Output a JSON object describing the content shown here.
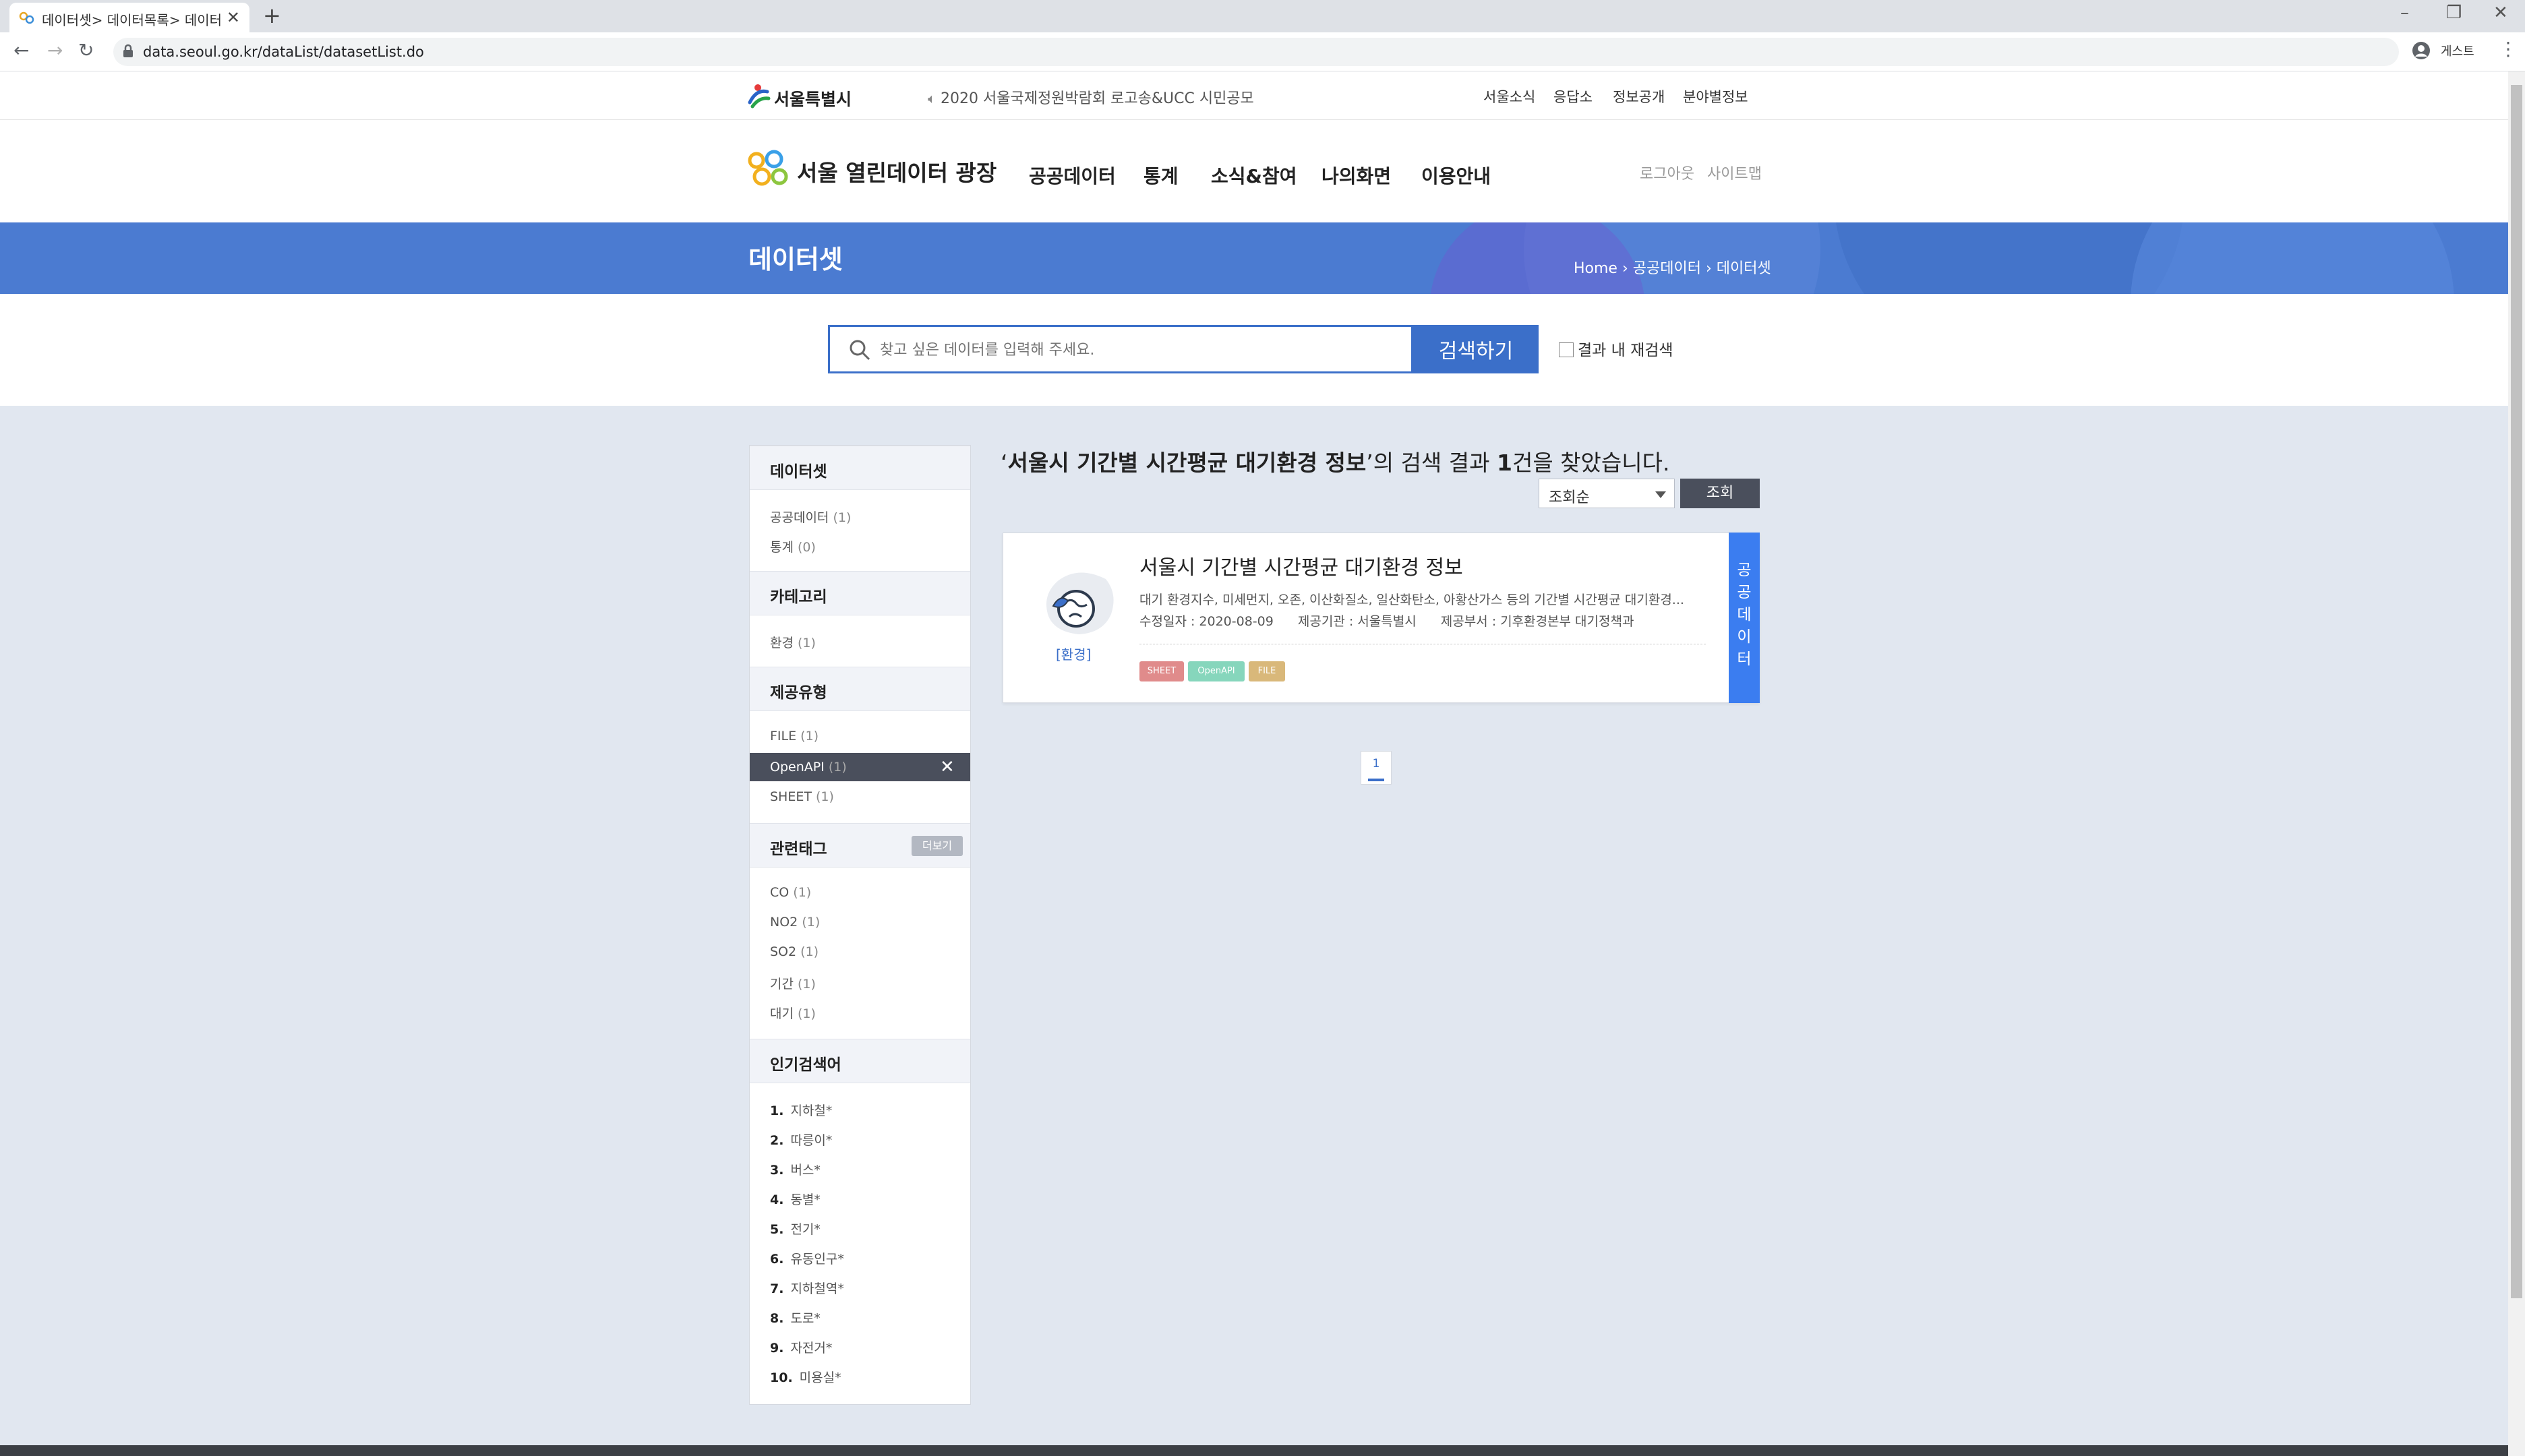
{
  "browser": {
    "tab_title": "데이터셋> 데이터목록> 데이터",
    "url": "data.seoul.go.kr/dataList/datasetList.do",
    "profile_label": "게스트"
  },
  "topbar": {
    "seoul_label": "서울특별시",
    "notice": "2020 서울국제정원박람회 로고송&UCC 시민공모",
    "links": [
      "서울소식",
      "응답소",
      "정보공개",
      "분야별정보"
    ]
  },
  "gnb": {
    "site_name": "서울 열린데이터 광장",
    "menu": [
      "공공데이터",
      "통계",
      "소식&참여",
      "나의화면",
      "이용안내"
    ],
    "logout": "로그아웃",
    "sitemap": "사이트맵"
  },
  "banner": {
    "title": "데이터셋",
    "breadcrumb": [
      "Home",
      "공공데이터",
      "데이터셋"
    ]
  },
  "search": {
    "placeholder": "찾고 싶은 데이터를 입력해 주세요.",
    "button": "검색하기",
    "research_label": "결과 내 재검색"
  },
  "sidebar": {
    "sections": [
      {
        "title": "데이터셋",
        "items": [
          {
            "label": "공공데이터",
            "count": "(1)"
          },
          {
            "label": "통계",
            "count": "(0)"
          }
        ]
      },
      {
        "title": "카테고리",
        "items": [
          {
            "label": "환경",
            "count": "(1)"
          }
        ]
      },
      {
        "title": "제공유형",
        "items": [
          {
            "label": "FILE",
            "count": "(1)"
          },
          {
            "label": "OpenAPI",
            "count": "(1)"
          },
          {
            "label": "SHEET",
            "count": "(1)"
          }
        ]
      },
      {
        "title": "관련태그",
        "more": "더보기",
        "items": [
          {
            "label": "CO",
            "count": "(1)"
          },
          {
            "label": "NO2",
            "count": "(1)"
          },
          {
            "label": "SO2",
            "count": "(1)"
          },
          {
            "label": "기간",
            "count": "(1)"
          },
          {
            "label": "대기",
            "count": "(1)"
          }
        ]
      },
      {
        "title": "인기검색어",
        "items": [
          {
            "rank": "1.",
            "label": "지하철*"
          },
          {
            "rank": "2.",
            "label": "따릉이*"
          },
          {
            "rank": "3.",
            "label": "버스*"
          },
          {
            "rank": "4.",
            "label": "동별*"
          },
          {
            "rank": "5.",
            "label": "전기*"
          },
          {
            "rank": "6.",
            "label": "유동인구*"
          },
          {
            "rank": "7.",
            "label": "지하철역*"
          },
          {
            "rank": "8.",
            "label": "도로*"
          },
          {
            "rank": "9.",
            "label": "자전거*"
          },
          {
            "rank": "10.",
            "label": "미용실*"
          }
        ]
      }
    ]
  },
  "results": {
    "query": "서울시 기간별 시간평균 대기환경 정보",
    "suffix1": "의 검색 결과 ",
    "count": "1",
    "suffix2": "건을 찾았습니다.",
    "sort_value": "조회순",
    "sort_button": "조회",
    "card": {
      "category": "[환경]",
      "title": "서울시 기간별 시간평균 대기환경 정보",
      "description": "대기 환경지수, 미세먼지, 오존, 이산화질소, 일산화탄소, 아황산가스 등의 기간별 시간평균 대기환경...",
      "modified": "수정일자 : 2020-08-09",
      "provider": "제공기관 : 서울특별시",
      "department": "제공부서 : 기후환경본부 대기정책과",
      "tags": [
        "SHEET",
        "OpenAPI",
        "FILE"
      ],
      "side_label": "공공데이터"
    },
    "page": "1"
  },
  "colors": {
    "primary": "#3b6fc9",
    "banner": "#4b7bd1",
    "tag_sheet": "#e07b7b",
    "tag_openapi": "#7fd3b8",
    "tag_file": "#d9b56e",
    "side_strip": "#3b7df0"
  }
}
